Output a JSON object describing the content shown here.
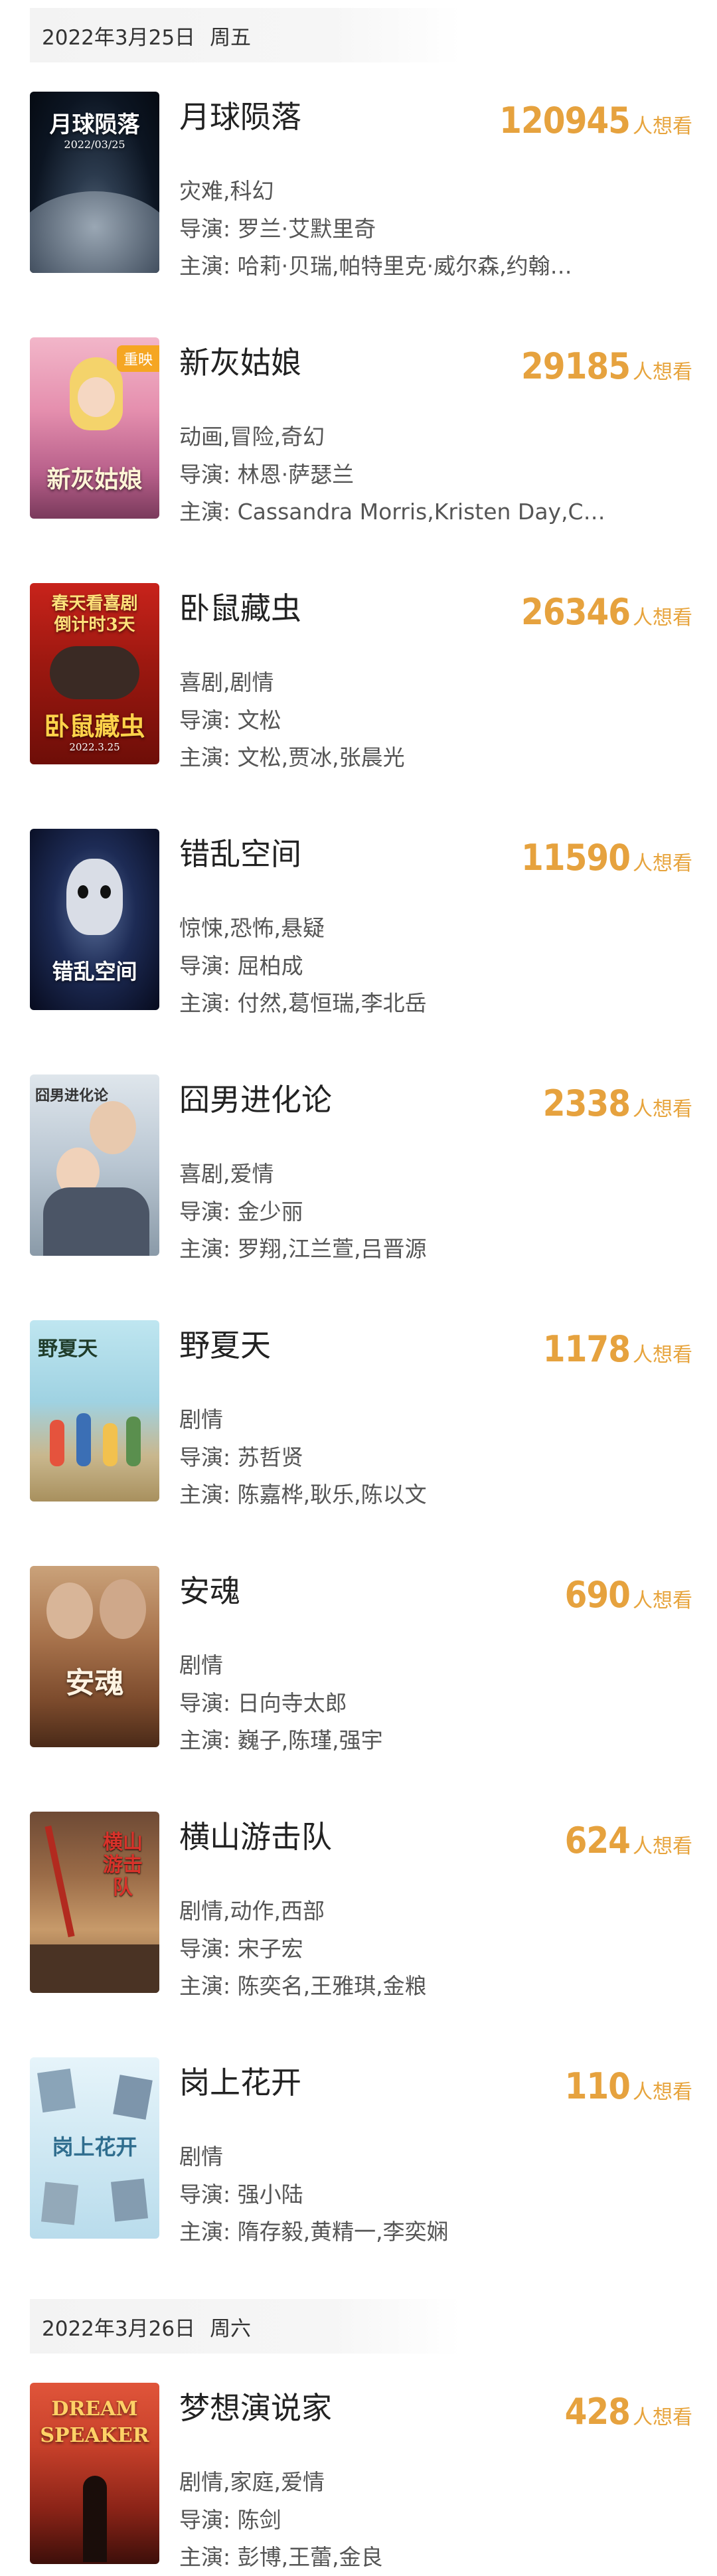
{
  "groups": [
    {
      "date": "2022年3月25日",
      "weekday": "周五",
      "movies": [
        {
          "title": "月球陨落",
          "count": "120945",
          "unit": "人想看",
          "genre": "灾难,科幻",
          "director": "导演: 罗兰·艾默里奇",
          "cast": "主演: 哈莉·贝瑞,帕特里克·威尔森,约翰…",
          "poster_text": "月球陨落",
          "poster_subtext": "2022/03/25"
        },
        {
          "title": "新灰姑娘",
          "count": "29185",
          "unit": "人想看",
          "genre": "动画,冒险,奇幻",
          "director": "导演: 林恩·萨瑟兰",
          "cast": "主演: Cassandra Morris,Kristen Day,C…",
          "poster_text": "新灰姑娘",
          "badge": "重映"
        },
        {
          "title": "卧鼠藏虫",
          "count": "26346",
          "unit": "人想看",
          "genre": "喜剧,剧情",
          "director": "导演: 文松",
          "cast": "主演: 文松,贾冰,张晨光",
          "poster_text": "卧鼠藏虫",
          "poster_top": "春天看喜剧",
          "poster_top2": "倒计时3天",
          "poster_subtext": "2022.3.25"
        },
        {
          "title": "错乱空间",
          "count": "11590",
          "unit": "人想看",
          "genre": "惊悚,恐怖,悬疑",
          "director": "导演: 屈柏成",
          "cast": "主演: 付然,葛恒瑞,李北岳",
          "poster_text": "错乱空间"
        },
        {
          "title": "囧男进化论",
          "count": "2338",
          "unit": "人想看",
          "genre": "喜剧,爱情",
          "director": "导演: 金少丽",
          "cast": "主演: 罗翔,江兰萱,吕晋源",
          "poster_text": "囧男进化论"
        },
        {
          "title": "野夏天",
          "count": "1178",
          "unit": "人想看",
          "genre": "剧情",
          "director": "导演: 苏哲贤",
          "cast": "主演: 陈嘉桦,耿乐,陈以文",
          "poster_text": "野夏天"
        },
        {
          "title": "安魂",
          "count": "690",
          "unit": "人想看",
          "genre": "剧情",
          "director": "导演: 日向寺太郎",
          "cast": "主演: 巍子,陈瑾,强宇",
          "poster_text": "安魂"
        },
        {
          "title": "横山游击队",
          "count": "624",
          "unit": "人想看",
          "genre": "剧情,动作,西部",
          "director": "导演: 宋子宏",
          "cast": "主演: 陈奕名,王雅琪,金粮",
          "poster_text": "横山游击队"
        },
        {
          "title": "岗上花开",
          "count": "110",
          "unit": "人想看",
          "genre": "剧情",
          "director": "导演: 强小陆",
          "cast": "主演: 隋存毅,黄精一,李奕娴",
          "poster_text": "岗上花开"
        }
      ]
    },
    {
      "date": "2022年3月26日",
      "weekday": "周六",
      "movies": [
        {
          "title": "梦想演说家",
          "count": "428",
          "unit": "人想看",
          "genre": "剧情,家庭,爱情",
          "director": "导演: 陈剑",
          "cast": "主演: 彭博,王蕾,金良",
          "poster_text": "DREAM SPEAKER"
        }
      ]
    }
  ],
  "colors": {
    "accent": "#e6a23e",
    "header_bg": "#f3f3f3",
    "text_primary": "#222222",
    "text_secondary": "#555555"
  }
}
